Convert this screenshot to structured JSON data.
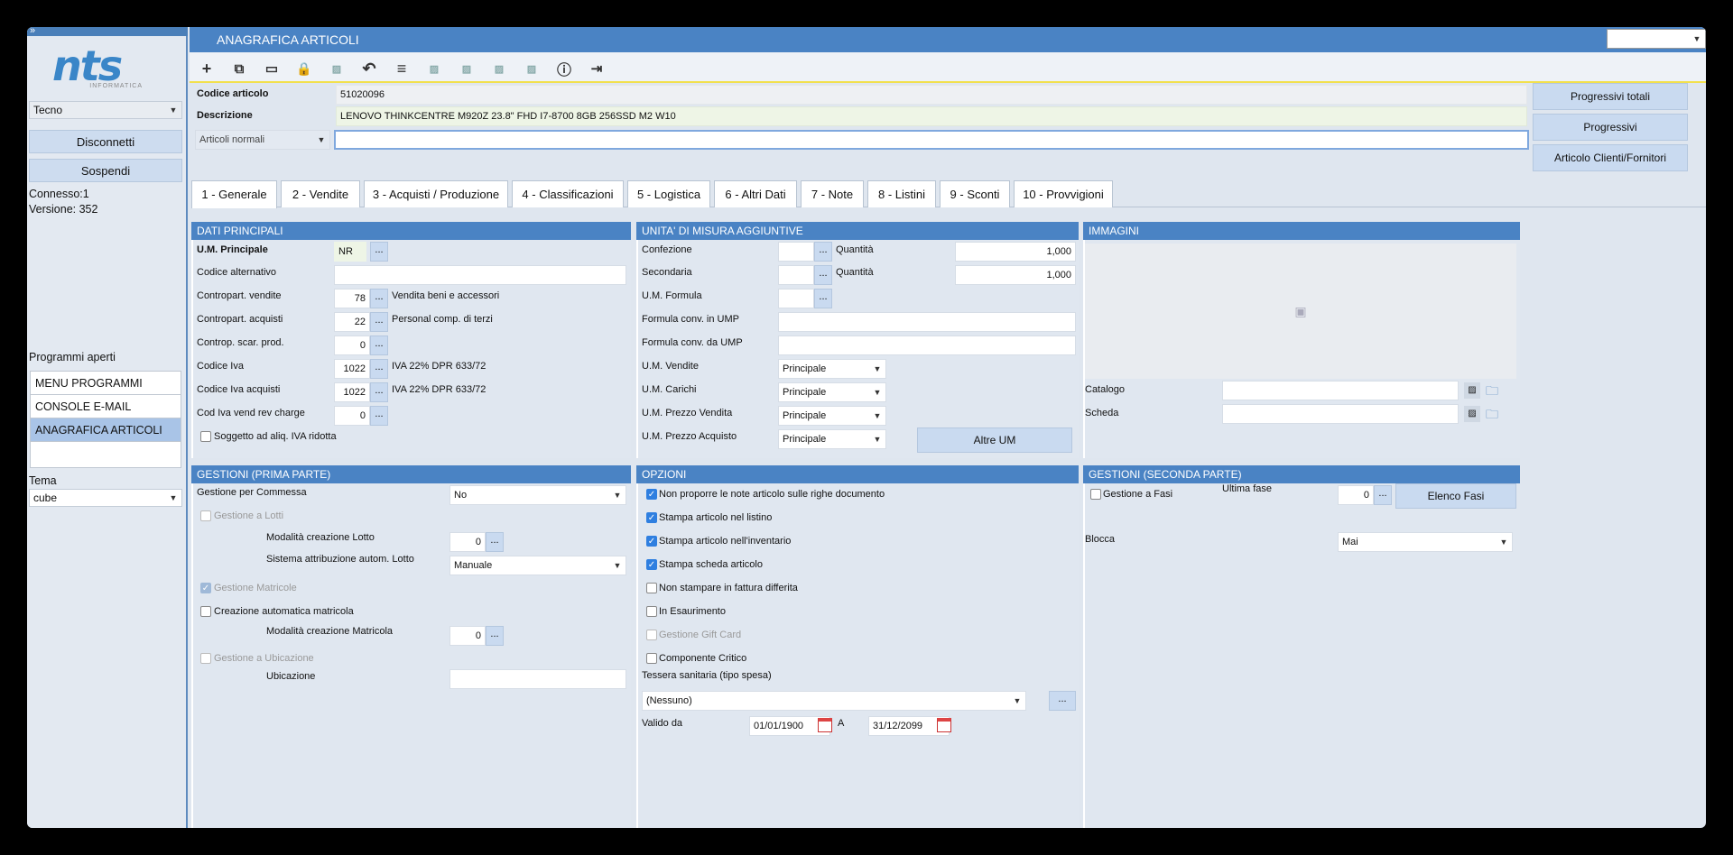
{
  "sidebar": {
    "top_icon": "»",
    "logo_text": "nts",
    "logo_sub": "INFORMATICA",
    "company": "Tecno",
    "disconnect": "Disconnetti",
    "suspend": "Sospendi",
    "connected": "Connesso:1",
    "version": "Versione: 352",
    "open_programs_label": "Programmi aperti",
    "programs": [
      "MENU PROGRAMMI",
      "CONSOLE E-MAIL",
      "ANAGRAFICA ARTICOLI",
      ""
    ],
    "theme_label": "Tema",
    "theme": "cube"
  },
  "window": {
    "title": "ANAGRAFICA ARTICOLI",
    "top_select": ""
  },
  "header": {
    "code_label": "Codice articolo",
    "code": "51020096",
    "desc_label": "Descrizione",
    "desc": "LENOVO THINKCENTRE M920Z 23.8\" FHD I7-8700 8GB 256SSD M2 W10",
    "type": "Articoli normali",
    "extra": "",
    "btn_totals": "Progressivi totali",
    "btn_prog": "Progressivi",
    "btn_clients": "Articolo Clienti/Fornitori"
  },
  "tabs": [
    "1 - Generale",
    "2 - Vendite",
    "3 - Acquisti / Produzione",
    "4 - Classificazioni",
    "5 - Logistica",
    "6 - Altri Dati",
    "7 - Note",
    "8 - Listini",
    "9 - Sconti",
    "10 - Provvigioni"
  ],
  "dati": {
    "title": "DATI PRINCIPALI",
    "um_label": "U.M. Principale",
    "um": "NR",
    "alt_label": "Codice alternativo",
    "alt": "",
    "cv_label": "Contropart. vendite",
    "cv": "78",
    "cv_desc": "Vendita beni e accessori",
    "ca_label": "Contropart. acquisti",
    "ca": "22",
    "ca_desc": "Personal comp. di terzi",
    "csp_label": "Controp. scar. prod.",
    "csp": "0",
    "iva_label": "Codice Iva",
    "iva": "1022",
    "iva_desc": "IVA 22% DPR 633/72",
    "ivaa_label": "Codice Iva acquisti",
    "ivaa": "1022",
    "ivaa_desc": "IVA 22% DPR 633/72",
    "rev_label": "Cod Iva vend rev charge",
    "rev": "0",
    "ridotta": "Soggetto ad aliq. IVA ridotta"
  },
  "unita": {
    "title": "UNITA' DI MISURA AGGIUNTIVE",
    "conf_label": "Confezione",
    "sec_label": "Secondaria",
    "qty_label": "Quantità",
    "qty1": "1,000",
    "qty2": "1,000",
    "formula_label": "U.M. Formula",
    "conv_in": "Formula conv. in UMP",
    "conv_da": "Formula conv. da UMP",
    "vend_label": "U.M. Vendite",
    "car_label": "U.M. Carichi",
    "pv_label": "U.M. Prezzo Vendita",
    "pa_label": "U.M. Prezzo Acquisto",
    "principale": "Principale",
    "altre": "Altre UM"
  },
  "immagini": {
    "title": "IMMAGINI",
    "catalogo": "Catalogo",
    "scheda": "Scheda"
  },
  "gest1": {
    "title": "GESTIONI (PRIMA PARTE)",
    "commessa_label": "Gestione per Commessa",
    "commessa": "No",
    "lotti": "Gestione a Lotti",
    "mod_lotto": "Modalità creazione Lotto",
    "mod_lotto_val": "0",
    "sist_lotto": "Sistema attribuzione autom. Lotto",
    "sist_lotto_val": "Manuale",
    "matricole": "Gestione Matricole",
    "crea_matr": "Creazione automatica matricola",
    "mod_matr": "Modalità creazione Matricola",
    "mod_matr_val": "0",
    "ubic": "Gestione a Ubicazione",
    "ubicazione": "Ubicazione"
  },
  "opzioni": {
    "title": "OPZIONI",
    "o1": "Non proporre le note articolo sulle righe documento",
    "o2": "Stampa articolo nel listino",
    "o3": "Stampa articolo nell'inventario",
    "o4": "Stampa scheda articolo",
    "o5": "Non stampare in fattura differita",
    "o6": "In Esaurimento",
    "o7": "Gestione Gift Card",
    "o8": "Componente Critico",
    "tessera": "Tessera sanitaria (tipo spesa)",
    "tessera_val": "(Nessuno)",
    "valido": "Valido da",
    "da": "01/01/1900",
    "a_label": "A",
    "a": "31/12/2099"
  },
  "gest2": {
    "title": "GESTIONI (SECONDA PARTE)",
    "fasi": "Gestione a Fasi",
    "ultima": "Ultima fase",
    "ultima_val": "0",
    "elenco": "Elenco Fasi",
    "blocca": "Blocca",
    "blocca_val": "Mai"
  },
  "common": {
    "dots": "..."
  }
}
